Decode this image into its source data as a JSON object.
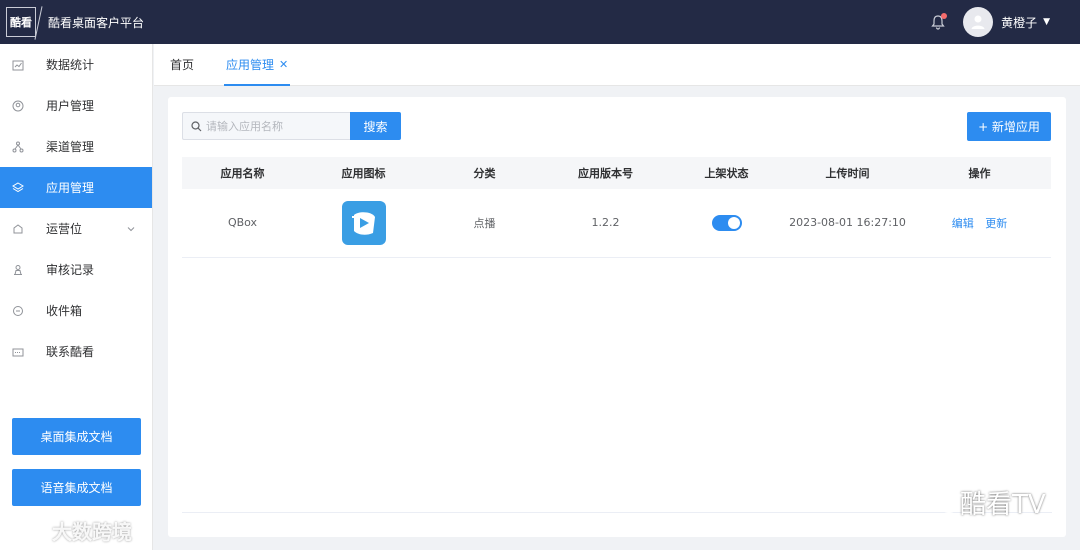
{
  "header": {
    "logo_text": "酷看",
    "app_title": "酷看桌面客户平台",
    "user_name": "黄橙子"
  },
  "sidebar": {
    "items": [
      {
        "label": "数据统计",
        "icon": "chart-icon"
      },
      {
        "label": "用户管理",
        "icon": "user-icon"
      },
      {
        "label": "渠道管理",
        "icon": "channel-icon"
      },
      {
        "label": "应用管理",
        "icon": "layers-icon",
        "active": true
      },
      {
        "label": "运营位",
        "icon": "operation-icon",
        "expandable": true
      },
      {
        "label": "审核记录",
        "icon": "audit-icon"
      },
      {
        "label": "收件箱",
        "icon": "inbox-icon"
      },
      {
        "label": "联系酷看",
        "icon": "contact-icon"
      }
    ],
    "doc_buttons": [
      "桌面集成文档",
      "语音集成文档"
    ]
  },
  "tabs": [
    {
      "label": "首页",
      "active": false
    },
    {
      "label": "应用管理",
      "active": true,
      "closable": true
    }
  ],
  "toolbar": {
    "search_placeholder": "请输入应用名称",
    "search_label": "搜索",
    "add_label": "+ 新增应用"
  },
  "table": {
    "columns": [
      "应用名称",
      "应用图标",
      "分类",
      "应用版本号",
      "上架状态",
      "上传时间",
      "操作"
    ],
    "rows": [
      {
        "name": "QBox",
        "category": "点播",
        "version": "1.2.2",
        "status_on": true,
        "upload_time": "2023-08-01 16:27:10",
        "actions": [
          "编辑",
          "更新"
        ]
      }
    ]
  },
  "watermarks": {
    "left": "大数跨境",
    "right": "酷看TV"
  },
  "colors": {
    "topbar": "#232a45",
    "primary": "#2d8cf0"
  }
}
